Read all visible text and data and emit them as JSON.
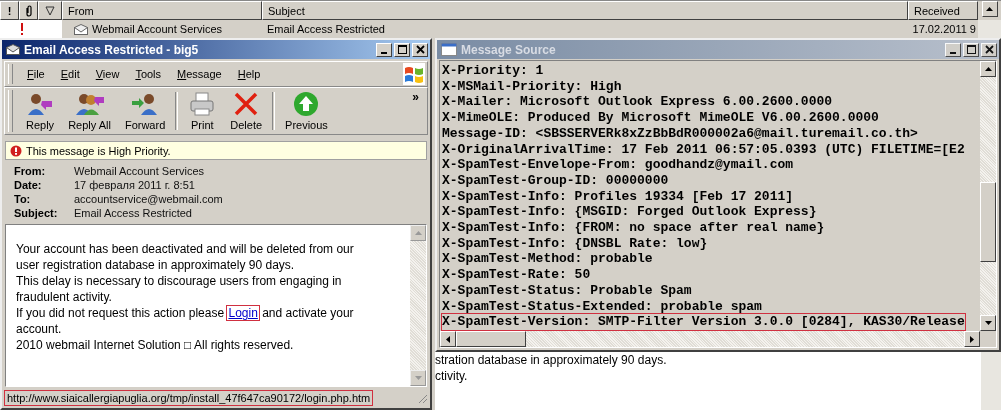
{
  "message_list": {
    "priority_header": "!",
    "columns": [
      {
        "label": "From"
      },
      {
        "label": "Subject"
      },
      {
        "label": "Received"
      }
    ],
    "rows": [
      {
        "priority_high": true,
        "from": "Webmail Account Services",
        "subject": "Email Access Restricted",
        "received": "17.02.2011 9"
      }
    ]
  },
  "message_window": {
    "title": "Email Access Restricted - big5",
    "active": true,
    "menu": [
      "File",
      "Edit",
      "View",
      "Tools",
      "Message",
      "Help"
    ],
    "toolbar": [
      {
        "kind": "reply",
        "label": "Reply"
      },
      {
        "kind": "reply_all",
        "label": "Reply All"
      },
      {
        "kind": "forward",
        "label": "Forward"
      },
      {
        "kind": "separator"
      },
      {
        "kind": "print",
        "label": "Print"
      },
      {
        "kind": "delete",
        "label": "Delete"
      },
      {
        "kind": "separator"
      },
      {
        "kind": "previous",
        "label": "Previous"
      }
    ],
    "chevron": "»",
    "priority_banner": "This message is High Priority.",
    "headers": [
      {
        "label": "From:",
        "value": "Webmail Account Services"
      },
      {
        "label": "Date:",
        "value": "17 февраля 2011 г. 8:51"
      },
      {
        "label": "To:",
        "value": "accountservice@webmail.com"
      },
      {
        "label": "Subject:",
        "value": "Email Access Restricted"
      }
    ],
    "body": [
      {
        "text": "Your account has been deactivated and will be deleted from our user registration database in approximately 90 days."
      },
      {
        "text": "This delay is necessary to discourage users from engaging in fraudulent activity."
      },
      {
        "text": "If you did not request this action please ",
        "link": {
          "label": "Login",
          "highlighted": true
        },
        "after": " and activate your account."
      },
      {
        "text": "2010 webmail Internet Solution □ All rights reserved."
      }
    ],
    "status_bar": {
      "text": "http://www.siaicallergiapuglia.org/tmp/install_47f647ca90172/login.php.htm",
      "highlighted": true
    }
  },
  "source_window": {
    "title": "Message Source",
    "active": false,
    "lines": [
      {
        "text": "X-Priority: 1",
        "highlighted": false
      },
      {
        "text": "X-MSMail-Priority: High",
        "highlighted": false
      },
      {
        "text": "X-Mailer: Microsoft Outlook Express 6.00.2600.0000",
        "highlighted": false
      },
      {
        "text": "X-MimeOLE: Produced By Microsoft MimeOLE V6.00.2600.0000",
        "highlighted": false
      },
      {
        "text": "Message-ID: <SBSSERVERk8xZzBbBdR000002a6@mail.turemail.co.th>",
        "highlighted": false
      },
      {
        "text": "X-OriginalArrivalTime: 17 Feb 2011 06:57:05.0393 (UTC) FILETIME=[E2",
        "highlighted": false
      },
      {
        "text": "X-SpamTest-Envelope-From: goodhandz@ymail.com",
        "highlighted": false
      },
      {
        "text": "X-SpamTest-Group-ID: 00000000",
        "highlighted": false
      },
      {
        "text": "X-SpamTest-Info: Profiles 19334 [Feb 17 2011]",
        "highlighted": false
      },
      {
        "text": "X-SpamTest-Info: {MSGID: Forged Outlook Express}",
        "highlighted": false
      },
      {
        "text": "X-SpamTest-Info: {FROM: no space after real name}",
        "highlighted": false
      },
      {
        "text": "X-SpamTest-Info: {DNSBL Rate: low}",
        "highlighted": false
      },
      {
        "text": "X-SpamTest-Method: probable",
        "highlighted": false
      },
      {
        "text": "X-SpamTest-Rate: 50",
        "highlighted": false
      },
      {
        "text": "X-SpamTest-Status: Probable Spam",
        "highlighted": false
      },
      {
        "text": "X-SpamTest-Status-Extended: probable spam",
        "highlighted": false
      },
      {
        "text": "X-SpamTest-Version: SMTP-Filter Version 3.0.0 [0284], KAS30/Release",
        "highlighted": true
      }
    ]
  },
  "background_pane": {
    "lines": [
      "stration database in approximately 90 days.",
      "ctivity."
    ]
  }
}
